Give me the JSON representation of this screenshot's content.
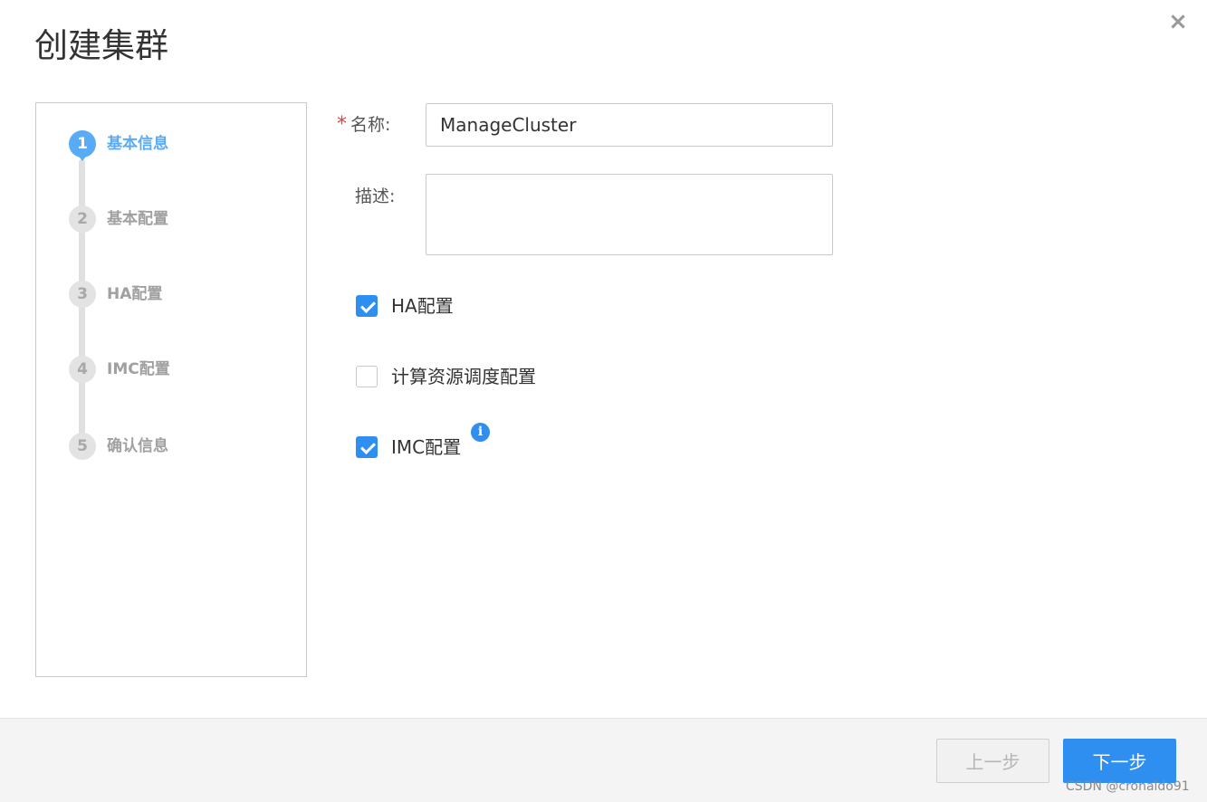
{
  "dialog": {
    "title": "创建集群",
    "close_icon": "×"
  },
  "steps": [
    {
      "number": "1",
      "label": "基本信息",
      "active": true
    },
    {
      "number": "2",
      "label": "基本配置",
      "active": false
    },
    {
      "number": "3",
      "label": "HA配置",
      "active": false
    },
    {
      "number": "4",
      "label": "IMC配置",
      "active": false
    },
    {
      "number": "5",
      "label": "确认信息",
      "active": false
    }
  ],
  "form": {
    "name_label": "名称:",
    "name_required_mark": "*",
    "name_value": "ManageCluster",
    "description_label": "描述:",
    "description_value": "",
    "options": [
      {
        "label": "HA配置",
        "checked": true
      },
      {
        "label": "计算资源调度配置",
        "checked": false
      },
      {
        "label": "IMC配置",
        "checked": true,
        "has_info_icon": true
      }
    ],
    "info_icon_glyph": "i"
  },
  "footer": {
    "prev_label": "上一步",
    "next_label": "下一步"
  },
  "watermark": "CSDN @cronaldo91",
  "colors": {
    "primary": "#2f8ff0",
    "step_active": "#5aabf6",
    "required": "#e5413e"
  },
  "icons": {
    "close": "close-icon",
    "check": "checkmark-icon",
    "info": "info-icon"
  }
}
